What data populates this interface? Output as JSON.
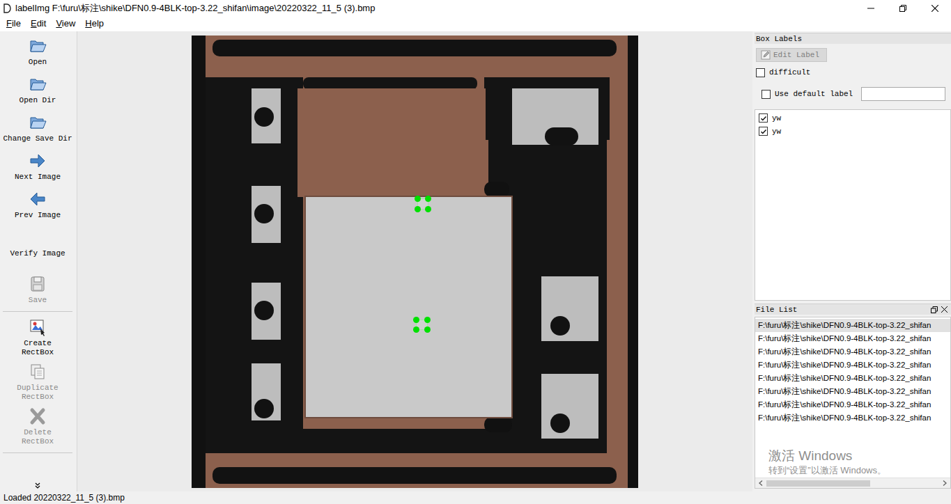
{
  "window": {
    "title": "labelImg F:\\furu\\标注\\shike\\DFN0.9-4BLK-top-3.22_shifan\\image\\20220322_11_5 (3).bmp"
  },
  "menu": [
    {
      "label": "File"
    },
    {
      "label": "Edit"
    },
    {
      "label": "View"
    },
    {
      "label": "Help"
    }
  ],
  "toolbar": {
    "groups": [
      [
        {
          "label": "Open",
          "kind": "open",
          "disabled": false
        },
        {
          "label": "Open Dir",
          "kind": "open",
          "disabled": false
        },
        {
          "label": "Change Save Dir",
          "kind": "open",
          "disabled": false
        },
        {
          "label": "Next Image",
          "kind": "next",
          "disabled": false
        },
        {
          "label": "Prev Image",
          "kind": "prev",
          "disabled": false
        },
        {
          "label": "Verify Image",
          "kind": "blank",
          "disabled": false
        },
        {
          "label": "Save",
          "kind": "save",
          "disabled": true
        }
      ],
      [
        {
          "label": "Create\nRectBox",
          "kind": "create",
          "disabled": false
        },
        {
          "label": "Duplicate\nRectBox",
          "kind": "duplicate",
          "disabled": true
        },
        {
          "label": "Delete\nRectBox",
          "kind": "delete",
          "disabled": true
        }
      ]
    ]
  },
  "box_labels": {
    "title": "Box Labels",
    "edit_button": {
      "label": "Edit Label",
      "disabled": true
    },
    "difficult": {
      "label": "difficult",
      "checked": false
    },
    "use_default": {
      "label": "Use default label",
      "checked": false,
      "value": ""
    },
    "items": [
      {
        "label": "yw",
        "checked": true,
        "selected": false
      },
      {
        "label": "yw",
        "checked": true,
        "selected": false
      }
    ]
  },
  "file_list": {
    "title": "File List",
    "items": [
      {
        "path": "F:\\furu\\标注\\shike\\DFN0.9-4BLK-top-3.22_shifan",
        "selected": true
      },
      {
        "path": "F:\\furu\\标注\\shike\\DFN0.9-4BLK-top-3.22_shifan",
        "selected": false
      },
      {
        "path": "F:\\furu\\标注\\shike\\DFN0.9-4BLK-top-3.22_shifan",
        "selected": false
      },
      {
        "path": "F:\\furu\\标注\\shike\\DFN0.9-4BLK-top-3.22_shifan",
        "selected": false
      },
      {
        "path": "F:\\furu\\标注\\shike\\DFN0.9-4BLK-top-3.22_shifan",
        "selected": false
      },
      {
        "path": "F:\\furu\\标注\\shike\\DFN0.9-4BLK-top-3.22_shifan",
        "selected": false
      },
      {
        "path": "F:\\furu\\标注\\shike\\DFN0.9-4BLK-top-3.22_shifan",
        "selected": false
      },
      {
        "path": "F:\\furu\\标注\\shike\\DFN0.9-4BLK-top-3.22_shifan",
        "selected": false
      }
    ],
    "scroll": {
      "level": 0.6
    }
  },
  "watermark": {
    "title": "激活 Windows",
    "subtitle": "转到“设置”以激活 Windows。"
  },
  "status_bar": {
    "text": "Loaded 20220322_11_5 (3).bmp"
  }
}
